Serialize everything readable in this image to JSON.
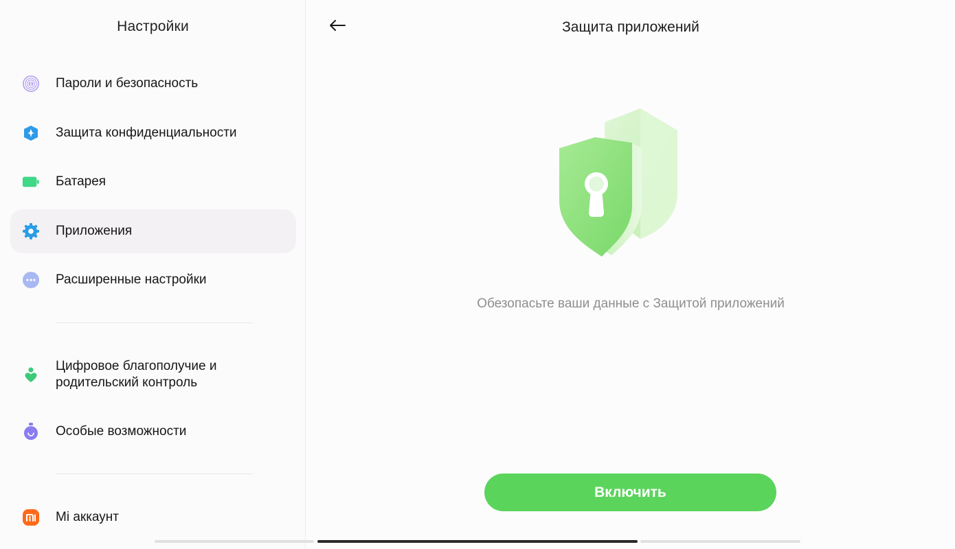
{
  "left_pane": {
    "title": "Настройки",
    "items": [
      {
        "label": "Пароли и безопасность",
        "icon": "fingerprint-icon"
      },
      {
        "label": "Защита конфиденциальности",
        "icon": "privacy-shield-icon"
      },
      {
        "label": "Батарея",
        "icon": "battery-icon"
      },
      {
        "label": "Приложения",
        "icon": "gear-icon",
        "active": true
      },
      {
        "label": "Расширенные настройки",
        "icon": "more-dots-icon"
      },
      {
        "label": "Цифровое благополучие и родительский контроль",
        "icon": "wellbeing-icon"
      },
      {
        "label": "Особые возможности",
        "icon": "accessibility-icon"
      },
      {
        "label": "Mi аккаунт",
        "icon": "mi-account-icon"
      }
    ]
  },
  "right_pane": {
    "title": "Защита приложений",
    "back_icon": "back-arrow-icon",
    "illustration": "shield-lock-icon",
    "description": "Обезопасьте ваши данные с Защитой приложений",
    "button_label": "Включить"
  },
  "colors": {
    "accent_green": "#5bd45c",
    "active_item_bg": "#f3f1f3",
    "description_gray": "#8e8e8e"
  }
}
